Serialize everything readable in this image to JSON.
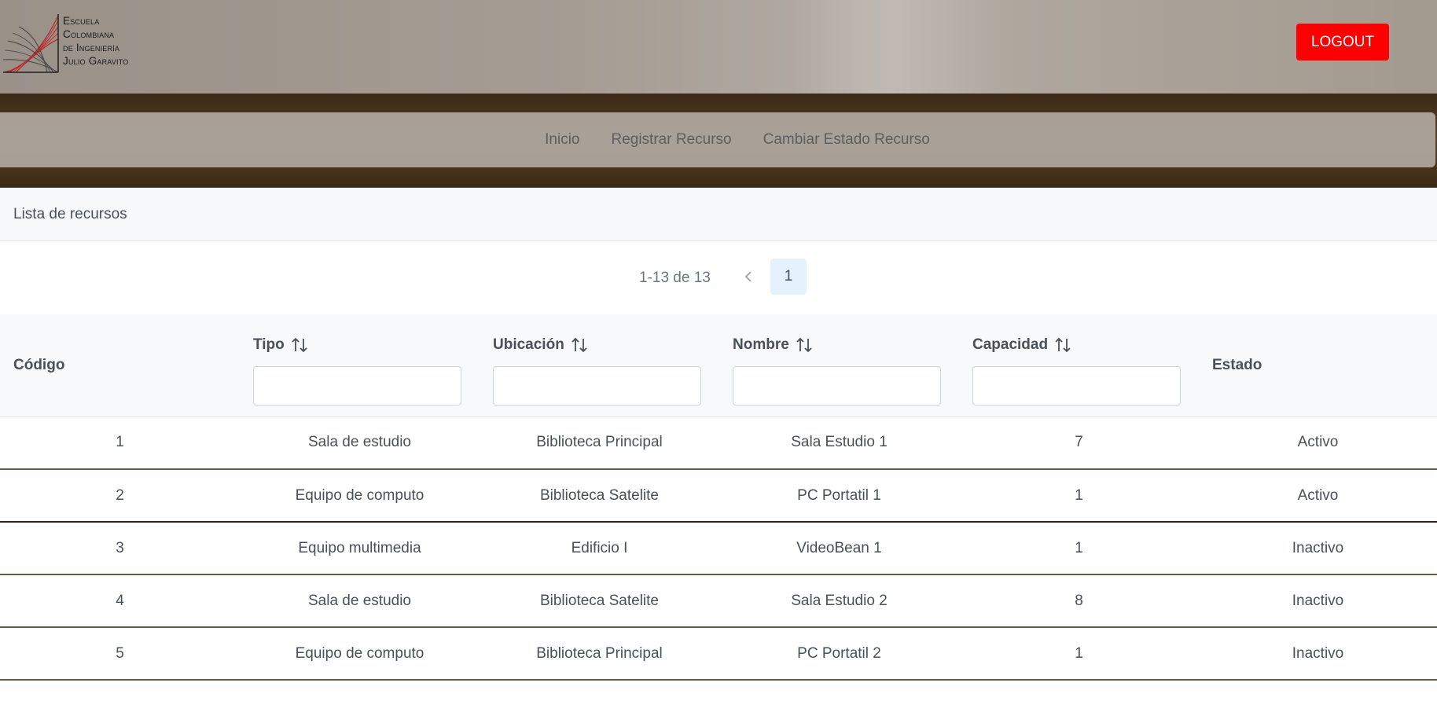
{
  "logo": {
    "lines": [
      "Escuela",
      "Colombiana",
      "de Ingeniería",
      "Julio Garavito"
    ]
  },
  "header": {
    "logout_label": "LOGOUT",
    "logout_color": "#ff0000"
  },
  "nav": {
    "items": [
      "Inicio",
      "Registrar Recurso",
      "Cambiar Estado Recurso"
    ]
  },
  "card": {
    "title": "Lista de recursos"
  },
  "paginator": {
    "report": "1-13 de 13",
    "current_page": "1",
    "prev_icon": "chevron-left-icon"
  },
  "table": {
    "columns": [
      {
        "label": "Código",
        "sortable": false,
        "filter": false
      },
      {
        "label": "Tipo",
        "sortable": true,
        "filter": true,
        "filter_value": ""
      },
      {
        "label": "Ubicación",
        "sortable": true,
        "filter": true,
        "filter_value": ""
      },
      {
        "label": "Nombre",
        "sortable": true,
        "filter": true,
        "filter_value": ""
      },
      {
        "label": "Capacidad",
        "sortable": true,
        "filter": true,
        "filter_value": ""
      },
      {
        "label": "Estado",
        "sortable": false,
        "filter": false
      }
    ],
    "rows": [
      [
        "1",
        "Sala de estudio",
        "Biblioteca Principal",
        "Sala Estudio 1",
        "7",
        "Activo"
      ],
      [
        "2",
        "Equipo de computo",
        "Biblioteca Satelite",
        "PC Portatil 1",
        "1",
        "Activo"
      ],
      [
        "3",
        "Equipo multimedia",
        "Edificio I",
        "VideoBean 1",
        "1",
        "Inactivo"
      ],
      [
        "4",
        "Sala de estudio",
        "Biblioteca Satelite",
        "Sala Estudio 2",
        "8",
        "Inactivo"
      ],
      [
        "5",
        "Equipo de computo",
        "Biblioteca Principal",
        "PC Portatil 2",
        "1",
        "Inactivo"
      ]
    ]
  }
}
